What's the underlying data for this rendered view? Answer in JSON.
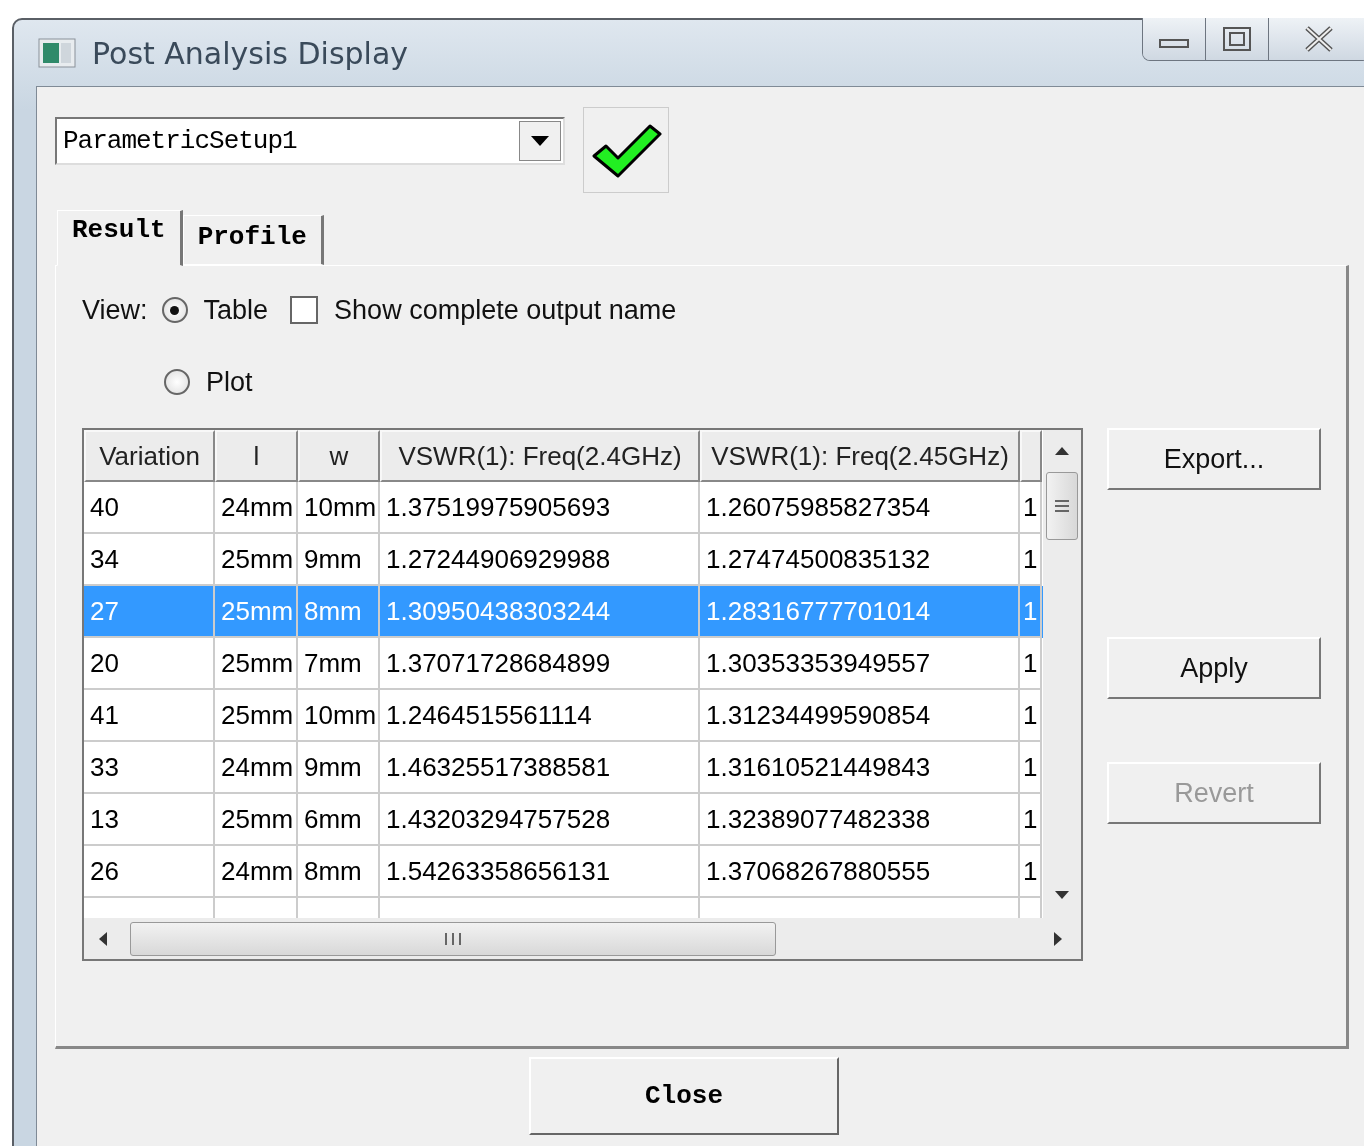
{
  "window": {
    "title": "Post Analysis Display"
  },
  "setup": {
    "value": "ParametricSetup1"
  },
  "tabs": [
    {
      "label": "Result",
      "selected": true
    },
    {
      "label": "Profile",
      "selected": false
    }
  ],
  "view": {
    "label": "View:",
    "options": [
      {
        "label": "Table",
        "selected": true
      },
      {
        "label": "Plot",
        "selected": false
      }
    ],
    "show_complete_output_name": {
      "label": "Show complete output name",
      "checked": false
    }
  },
  "table": {
    "columns": [
      "Variation",
      "l",
      "w",
      "VSWR(1): Freq(2.4GHz)",
      "VSWR(1): Freq(2.45GHz)"
    ],
    "rows": [
      {
        "cells": [
          "40",
          "24mm",
          "10mm",
          "1.37519975905693",
          "1.26075985827354",
          "1"
        ],
        "selected": false
      },
      {
        "cells": [
          "34",
          "25mm",
          "9mm",
          "1.27244906929988",
          "1.27474500835132",
          "1"
        ],
        "selected": false
      },
      {
        "cells": [
          "27",
          "25mm",
          "8mm",
          "1.30950438303244",
          "1.28316777701014",
          "1"
        ],
        "selected": true
      },
      {
        "cells": [
          "20",
          "25mm",
          "7mm",
          "1.37071728684899",
          "1.30353353949557",
          "1"
        ],
        "selected": false
      },
      {
        "cells": [
          "41",
          "25mm",
          "10mm",
          "1.2464515561114",
          "1.31234499590854",
          "1"
        ],
        "selected": false
      },
      {
        "cells": [
          "33",
          "24mm",
          "9mm",
          "1.46325517388581",
          "1.31610521449843",
          "1"
        ],
        "selected": false
      },
      {
        "cells": [
          "13",
          "25mm",
          "6mm",
          "1.43203294757528",
          "1.32389077482338",
          "1"
        ],
        "selected": false
      },
      {
        "cells": [
          "26",
          "24mm",
          "8mm",
          "1.54263358656131",
          "1.37068267880555",
          "1"
        ],
        "selected": false
      }
    ]
  },
  "buttons": [
    {
      "label": "Export...",
      "disabled": false
    },
    {
      "label": "Apply",
      "disabled": false
    },
    {
      "label": "Revert",
      "disabled": true
    }
  ],
  "close_button": {
    "label": "Close"
  }
}
